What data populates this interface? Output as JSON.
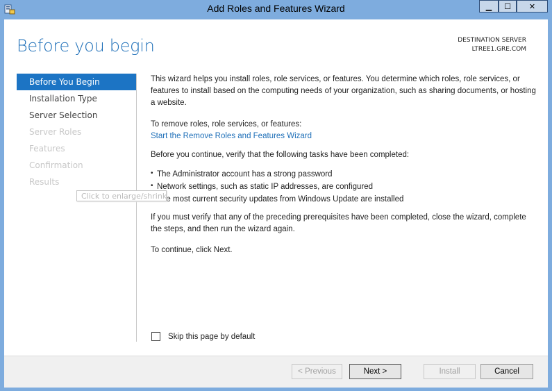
{
  "window": {
    "title": "Add Roles and Features Wizard",
    "controls": {
      "minimize": "▁",
      "maximize": "☐",
      "close": "✕"
    },
    "app_icon": "server-manager-icon"
  },
  "header": {
    "page_title": "Before you begin",
    "destination_label": "DESTINATION SERVER",
    "destination_server": "LTREE1.GRE.COM"
  },
  "nav": {
    "items": [
      {
        "label": "Before You Begin",
        "state": "active"
      },
      {
        "label": "Installation Type",
        "state": "enabled"
      },
      {
        "label": "Server Selection",
        "state": "enabled"
      },
      {
        "label": "Server Roles",
        "state": "disabled"
      },
      {
        "label": "Features",
        "state": "disabled"
      },
      {
        "label": "Confirmation",
        "state": "disabled"
      },
      {
        "label": "Results",
        "state": "disabled"
      }
    ]
  },
  "content": {
    "intro": "This wizard helps you install roles, role services, or features. You determine which roles, role services, or features to install based on the computing needs of your organization, such as sharing documents, or hosting a website.",
    "remove_label": "To remove roles, role services, or features:",
    "remove_link": "Start the Remove Roles and Features Wizard",
    "verify_intro": "Before you continue, verify that the following tasks have been completed:",
    "tasks": [
      "The Administrator account has a strong password",
      "Network settings, such as static IP addresses, are configured",
      "The most current security updates from Windows Update are installed"
    ],
    "prereq_note": "If you must verify that any of the preceding prerequisites have been completed, close the wizard, complete the steps, and then run the wizard again.",
    "continue_note": "To continue, click Next."
  },
  "tooltip": "Click to enlarge/shrink",
  "skip_checkbox": {
    "label": "Skip this page by default",
    "checked": false
  },
  "footer": {
    "previous": "< Previous",
    "next": "Next >",
    "install": "Install",
    "cancel": "Cancel"
  },
  "colors": {
    "accent": "#1c74c4",
    "title_blue": "#1e6fb8",
    "frame": "#7eacde"
  }
}
